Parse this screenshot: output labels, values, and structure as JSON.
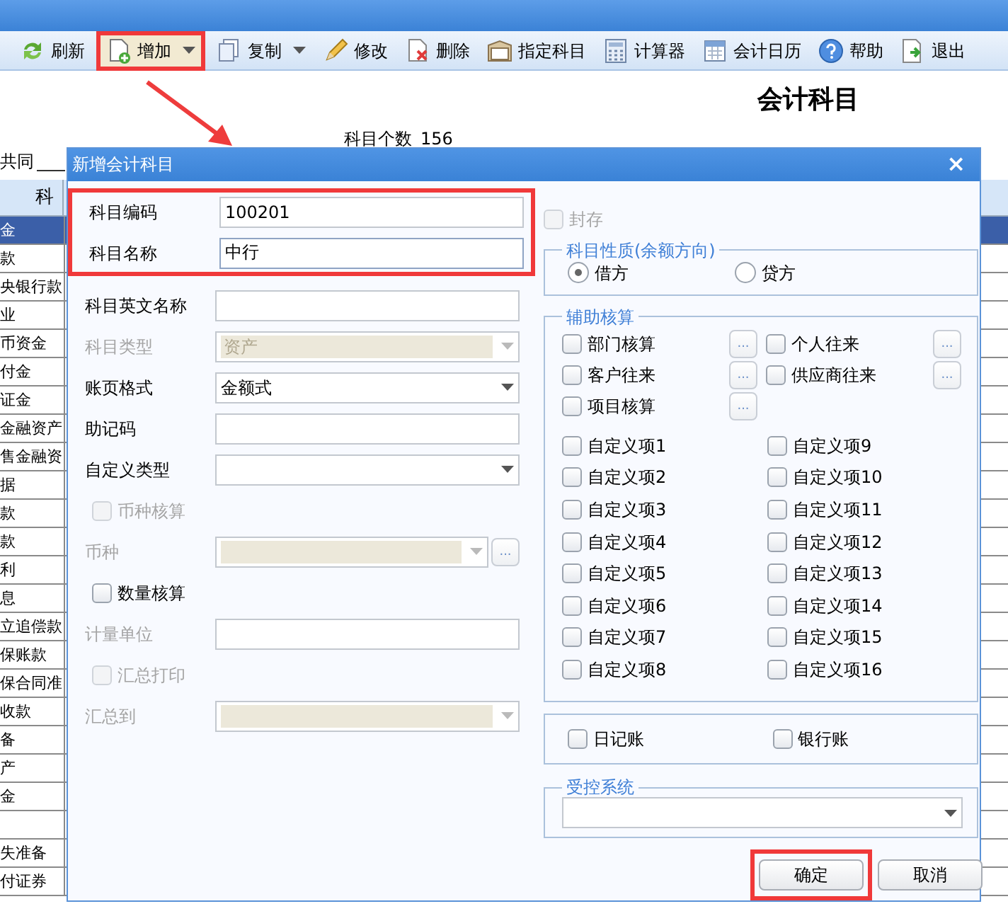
{
  "toolbar": [
    {
      "label": "刷新",
      "dropdown": false,
      "annotated": false
    },
    {
      "label": "增加",
      "dropdown": true,
      "annotated": true
    },
    {
      "label": "复制",
      "dropdown": true,
      "annotated": false
    },
    {
      "label": "修改",
      "dropdown": false,
      "annotated": false
    },
    {
      "label": "删除",
      "dropdown": false,
      "annotated": false
    },
    {
      "label": "指定科目",
      "dropdown": false,
      "annotated": false
    },
    {
      "label": "计算器",
      "dropdown": false,
      "annotated": false
    },
    {
      "label": "会计日历",
      "dropdown": false,
      "annotated": false
    },
    {
      "label": "帮助",
      "dropdown": false,
      "annotated": false
    },
    {
      "label": "退出",
      "dropdown": false,
      "annotated": false
    }
  ],
  "page": {
    "title": "会计科目",
    "count_label": "科目个数",
    "count": "156",
    "filter_label": "共同"
  },
  "table": {
    "column_1": "科",
    "rows": [
      {
        "text": "金",
        "selected": true
      },
      {
        "text": "款",
        "selected": false
      },
      {
        "text": "央银行款",
        "selected": false
      },
      {
        "text": "业",
        "selected": false
      },
      {
        "text": "币资金",
        "selected": false
      },
      {
        "text": "付金",
        "selected": false
      },
      {
        "text": "证金",
        "selected": false
      },
      {
        "text": "金融资产",
        "selected": false
      },
      {
        "text": "售金融资",
        "selected": false
      },
      {
        "text": "据",
        "selected": false
      },
      {
        "text": "款",
        "selected": false
      },
      {
        "text": "款",
        "selected": false
      },
      {
        "text": "利",
        "selected": false
      },
      {
        "text": "息",
        "selected": false
      },
      {
        "text": "立追偿款",
        "selected": false
      },
      {
        "text": "保账款",
        "selected": false
      },
      {
        "text": "保合同准",
        "selected": false
      },
      {
        "text": "收款",
        "selected": false
      },
      {
        "text": "备",
        "selected": false
      },
      {
        "text": "产",
        "selected": false
      },
      {
        "text": "金",
        "selected": false
      },
      {
        "selected": false
      },
      {
        "text": "失准备",
        "selected": false
      },
      {
        "text": "付证券",
        "selected": false
      }
    ]
  },
  "dialog": {
    "title": "新增会计科目",
    "close": "×",
    "key_fields": {
      "annotated": true,
      "fields": [
        {
          "kind": "text",
          "label": "科目编码",
          "value": "100201",
          "focused": false
        },
        {
          "kind": "text",
          "label": "科目名称",
          "value": "中行",
          "focused": true
        }
      ]
    },
    "fields": [
      {
        "kind": "text",
        "label": "科目英文名称",
        "disabled": false
      },
      {
        "kind": "select",
        "label": "科目类型",
        "value": "资产",
        "disabled": true
      },
      {
        "kind": "select",
        "label": "账页格式",
        "value": "金额式",
        "disabled": false
      },
      {
        "kind": "text",
        "label": "助记码",
        "disabled": false
      },
      {
        "kind": "select",
        "label": "自定义类型",
        "disabled": false
      },
      {
        "kind": "check",
        "label": "币种核算",
        "checked": false,
        "disabled": true
      },
      {
        "kind": "select",
        "label": "币种",
        "disabled": true,
        "browse": "..."
      },
      {
        "kind": "check",
        "label": "数量核算",
        "checked": false,
        "disabled": false
      },
      {
        "kind": "text",
        "label": "计量单位",
        "disabled": true
      },
      {
        "kind": "check",
        "label": "汇总打印",
        "checked": false,
        "disabled": true
      },
      {
        "kind": "select",
        "label": "汇总到",
        "disabled": true
      }
    ],
    "sealed": {
      "label": "封存",
      "checked": false,
      "disabled": true
    },
    "balance": {
      "legend": "科目性质(余额方向)",
      "options": [
        {
          "label": "借方",
          "selected": true
        },
        {
          "label": "贷方",
          "selected": false
        }
      ]
    },
    "auxiliary": {
      "legend": "辅助核算",
      "items": [
        {
          "label": "部门核算",
          "checked": false,
          "browse": "..."
        },
        {
          "label": "个人往来",
          "checked": false,
          "browse": "..."
        },
        {
          "label": "客户往来",
          "checked": false,
          "browse": "..."
        },
        {
          "label": "供应商往来",
          "checked": false,
          "browse": "..."
        },
        {
          "label": "项目核算",
          "checked": false,
          "browse": "..."
        }
      ],
      "custom": [
        {
          "label": "自定义项1",
          "checked": false
        },
        {
          "label": "自定义项2",
          "checked": false
        },
        {
          "label": "自定义项3",
          "checked": false
        },
        {
          "label": "自定义项4",
          "checked": false
        },
        {
          "label": "自定义项5",
          "checked": false
        },
        {
          "label": "自定义项6",
          "checked": false
        },
        {
          "label": "自定义项7",
          "checked": false
        },
        {
          "label": "自定义项8",
          "checked": false
        },
        {
          "label": "自定义项9",
          "checked": false
        },
        {
          "label": "自定义项10",
          "checked": false
        },
        {
          "label": "自定义项11",
          "checked": false
        },
        {
          "label": "自定义项12",
          "checked": false
        },
        {
          "label": "自定义项13",
          "checked": false
        },
        {
          "label": "自定义项14",
          "checked": false
        },
        {
          "label": "自定义项15",
          "checked": false
        },
        {
          "label": "自定义项16",
          "checked": false
        }
      ]
    },
    "ledgers": [
      {
        "label": "日记账",
        "checked": false
      },
      {
        "label": "银行账",
        "checked": false
      }
    ],
    "controlled": {
      "legend": "受控系统"
    },
    "buttons": [
      {
        "label": "确定",
        "annotated": true
      },
      {
        "label": "取消",
        "annotated": false
      }
    ]
  }
}
